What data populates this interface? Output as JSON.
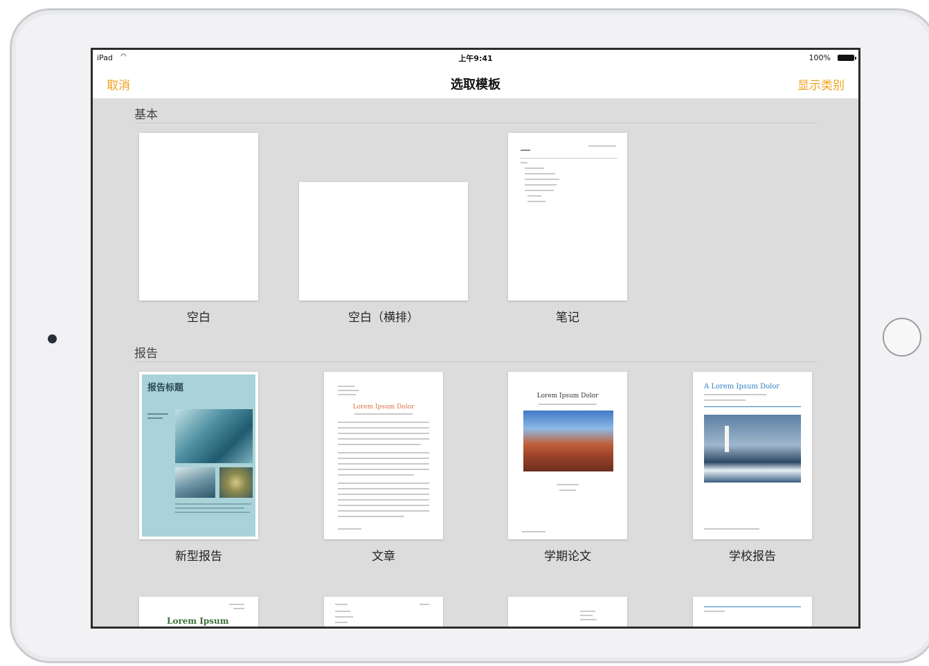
{
  "status_bar": {
    "carrier": "iPad",
    "time": "上午9:41",
    "battery": "100%"
  },
  "nav": {
    "cancel": "取消",
    "title": "选取模板",
    "show_categories": "显示类别"
  },
  "sections": {
    "basic": {
      "title": "基本",
      "templates": [
        "空白",
        "空白（横排）",
        "笔记"
      ]
    },
    "report": {
      "title": "报告",
      "templates": [
        "新型报告",
        "文章",
        "学期论文",
        "学校报告"
      ]
    }
  },
  "thumbs": {
    "new_report_heading": "报告标题",
    "essay_title": "Lorem Ipsum Dolor",
    "term_paper_title": "Lorem Ipsum Dolor",
    "school_report_title": "A Lorem Ipsum Dolor",
    "row3_first_title": "Lorem Ipsum"
  },
  "colors": {
    "accent": "#f0a11c",
    "screen_bg": "#dcdcdc"
  }
}
